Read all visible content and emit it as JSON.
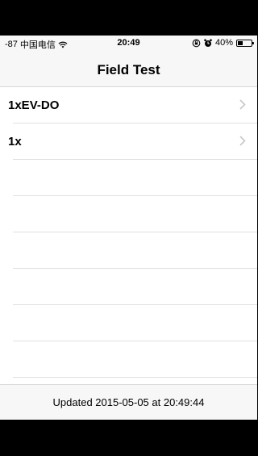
{
  "status_bar": {
    "signal": "-87",
    "carrier": "中国电信",
    "time": "20:49",
    "battery_percent_text": "40%",
    "battery_level": 0.4,
    "icons": [
      "wifi-icon",
      "lock-rotation-icon",
      "alarm-icon",
      "battery-icon"
    ]
  },
  "nav": {
    "title": "Field Test"
  },
  "list": {
    "items": [
      {
        "label": "1xEV-DO",
        "icon": "chevron-right-icon"
      },
      {
        "label": "1x",
        "icon": "chevron-right-icon"
      }
    ]
  },
  "footer": {
    "updated_text": "Updated 2015-05-05 at 20:49:44"
  }
}
